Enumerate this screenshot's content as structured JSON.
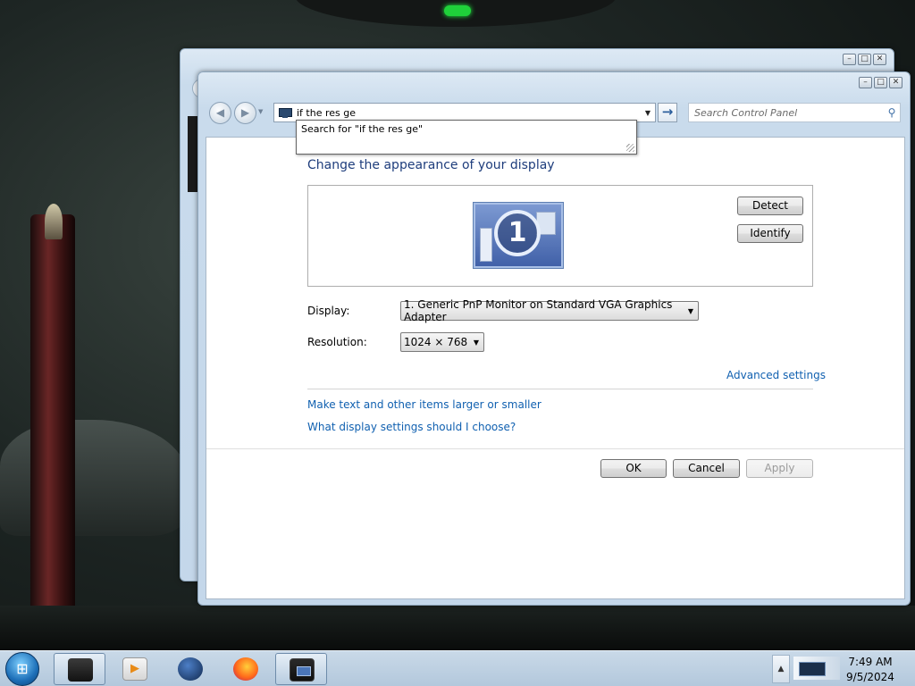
{
  "address_bar": {
    "value": "if the res ge",
    "suggestion": "Search for \"if the res ge\""
  },
  "search": {
    "placeholder": "Search Control Panel"
  },
  "page": {
    "heading": "Change the appearance of your display",
    "monitor_number": "1",
    "detect_label": "Detect",
    "identify_label": "Identify",
    "display_label": "Display:",
    "display_value": "1. Generic PnP Monitor on Standard VGA Graphics Adapter",
    "resolution_label": "Resolution:",
    "resolution_value": "1024 × 768",
    "advanced_link": "Advanced settings",
    "larger_link": "Make text and other items larger or smaller",
    "choose_link": "What display settings should I choose?",
    "ok_label": "OK",
    "cancel_label": "Cancel",
    "apply_label": "Apply"
  },
  "taskbar": {
    "items": [
      "windows-explorer-icon",
      "media-player-icon",
      "globe-icon",
      "firefox-icon",
      "display-settings-icon"
    ],
    "clock_time": "7:49 AM",
    "clock_date": "9/5/2024"
  },
  "colors": {
    "heading": "#1e3d7c",
    "link": "#1060b0",
    "taskbar": "#b3c8dc"
  }
}
